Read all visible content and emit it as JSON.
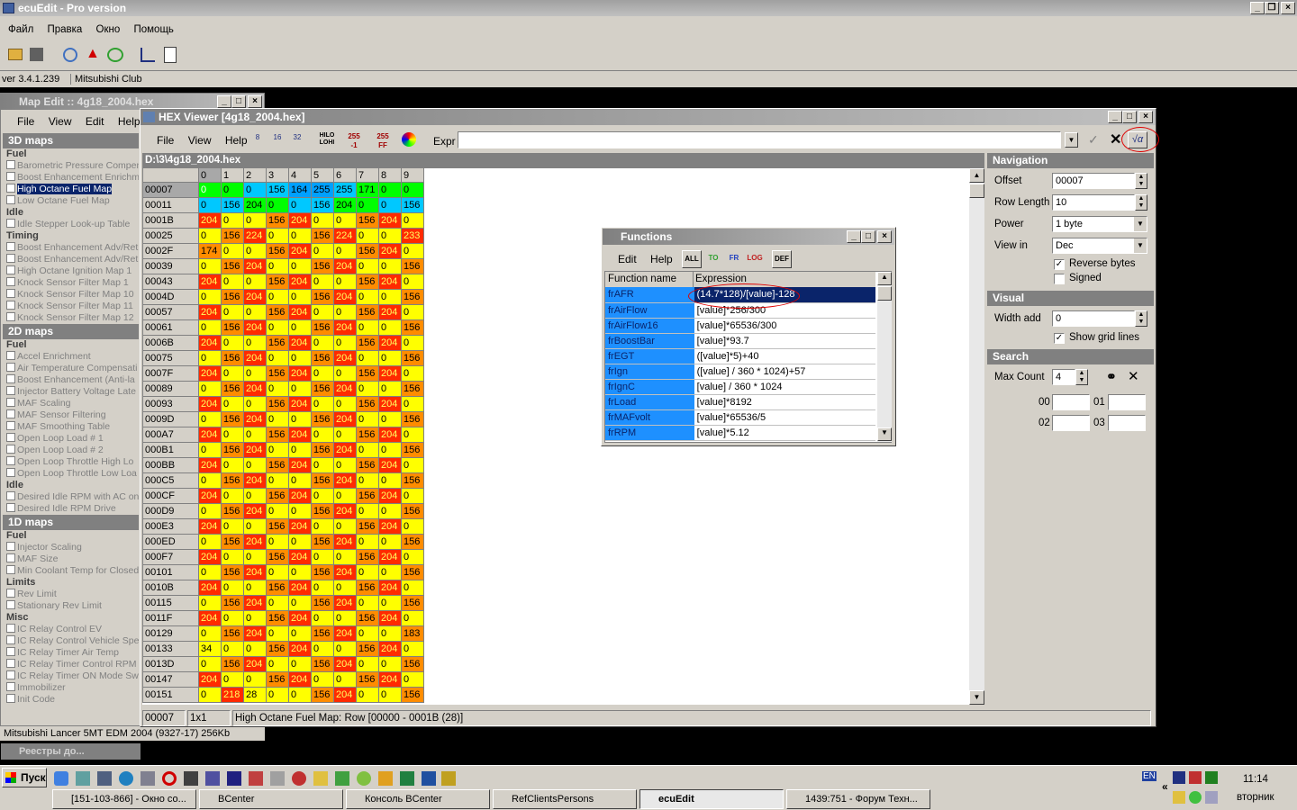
{
  "app": {
    "title": "ecuEdit - Pro version",
    "menu": [
      "Файл",
      "Правка",
      "Окно",
      "Помощь"
    ],
    "version": "ver 3.4.1.239",
    "club": "Mitsubishi Club",
    "status_car": "Mitsubishi Lancer  5MT EDM 2004 (9327-17)  256Kb"
  },
  "map_edit": {
    "title": "Map Edit :: 4g18_2004.hex",
    "menu": [
      "File",
      "View",
      "Edit",
      "Help"
    ]
  },
  "sections": [
    {
      "title": "3D maps",
      "groups": [
        {
          "name": "Fuel",
          "items": [
            "Barometric Pressure Compen",
            "Boost Enhancement Enrichm",
            "High Octane Fuel Map",
            "Low Octane Fuel Map"
          ]
        },
        {
          "name": "Idle",
          "items": [
            "Idle Stepper Look-up Table"
          ]
        },
        {
          "name": "Timing",
          "items": [
            "Boost Enhancement Adv/Ret",
            "Boost Enhancement Adv/Ret",
            "High Octane Ignition Map 1",
            "Knock Sensor Filter Map 1",
            "Knock Sensor Filter Map 10",
            "Knock Sensor Filter Map 11",
            "Knock Sensor Filter Map 12"
          ]
        }
      ]
    },
    {
      "title": "2D maps",
      "groups": [
        {
          "name": "Fuel",
          "items": [
            "Accel Enrichment",
            "Air Temperature Compensati",
            "Boost Enhancement (Anti-la",
            "Injector Battery Voltage Late",
            "MAF Scaling",
            "MAF Sensor Filtering",
            "MAF Smoothing Table",
            "Open Loop Load # 1",
            "Open Loop Load # 2",
            "Open Loop Throttle High Lo",
            "Open Loop Throttle Low Loa"
          ]
        },
        {
          "name": "Idle",
          "items": [
            "Desired Idle RPM with AC on",
            "Desired Idle RPM Drive"
          ]
        }
      ]
    },
    {
      "title": "1D maps",
      "groups": [
        {
          "name": "Fuel",
          "items": [
            "Injector Scaling",
            "MAF Size",
            "Min Coolant Temp for Closed"
          ]
        },
        {
          "name": "Limits",
          "items": [
            "Rev Limit",
            "Stationary Rev Limit"
          ]
        },
        {
          "name": "Misc",
          "items": [
            "IC Relay Control EV",
            "IC Relay Control Vehicle Spe",
            "IC Relay Timer Air Temp",
            "IC Relay Timer Control RPM",
            "IC Relay Timer ON Mode Sw",
            "Immobilizer",
            "Init Code"
          ]
        }
      ]
    }
  ],
  "selected_item": "High Octane Fuel Map",
  "hex": {
    "title": "HEX Viewer [4g18_2004.hex]",
    "menu": [
      "File",
      "View",
      "Help"
    ],
    "expr_label": "Expr",
    "expr_value": "",
    "path": "D:\\3\\4g18_2004.hex",
    "toolbar": [
      "8",
      "16",
      "32",
      "HILO LOHI",
      "255 -1",
      "255 FF"
    ],
    "columns": [
      "0",
      "1",
      "2",
      "3",
      "4",
      "5",
      "6",
      "7",
      "8",
      "9"
    ],
    "rows": [
      [
        "00007",
        "0",
        "0",
        "0",
        "156",
        "164",
        "255",
        "255",
        "171",
        "0",
        "0"
      ],
      [
        "00011",
        "0",
        "156",
        "204",
        "0",
        "0",
        "156",
        "204",
        "0",
        "0",
        "156"
      ],
      [
        "0001B",
        "204",
        "0",
        "0",
        "156",
        "204",
        "0",
        "0",
        "156",
        "204",
        "0"
      ],
      [
        "00025",
        "0",
        "156",
        "224",
        "0",
        "0",
        "156",
        "224",
        "0",
        "0",
        "233"
      ],
      [
        "0002F",
        "174",
        "0",
        "0",
        "156",
        "204",
        "0",
        "0",
        "156",
        "204",
        "0"
      ],
      [
        "00039",
        "0",
        "156",
        "204",
        "0",
        "0",
        "156",
        "204",
        "0",
        "0",
        "156"
      ],
      [
        "00043",
        "204",
        "0",
        "0",
        "156",
        "204",
        "0",
        "0",
        "156",
        "204",
        "0"
      ],
      [
        "0004D",
        "0",
        "156",
        "204",
        "0",
        "0",
        "156",
        "204",
        "0",
        "0",
        "156"
      ],
      [
        "00057",
        "204",
        "0",
        "0",
        "156",
        "204",
        "0",
        "0",
        "156",
        "204",
        "0"
      ],
      [
        "00061",
        "0",
        "156",
        "204",
        "0",
        "0",
        "156",
        "204",
        "0",
        "0",
        "156"
      ],
      [
        "0006B",
        "204",
        "0",
        "0",
        "156",
        "204",
        "0",
        "0",
        "156",
        "204",
        "0"
      ],
      [
        "00075",
        "0",
        "156",
        "204",
        "0",
        "0",
        "156",
        "204",
        "0",
        "0",
        "156"
      ],
      [
        "0007F",
        "204",
        "0",
        "0",
        "156",
        "204",
        "0",
        "0",
        "156",
        "204",
        "0"
      ],
      [
        "00089",
        "0",
        "156",
        "204",
        "0",
        "0",
        "156",
        "204",
        "0",
        "0",
        "156"
      ],
      [
        "00093",
        "204",
        "0",
        "0",
        "156",
        "204",
        "0",
        "0",
        "156",
        "204",
        "0"
      ],
      [
        "0009D",
        "0",
        "156",
        "204",
        "0",
        "0",
        "156",
        "204",
        "0",
        "0",
        "156"
      ],
      [
        "000A7",
        "204",
        "0",
        "0",
        "156",
        "204",
        "0",
        "0",
        "156",
        "204",
        "0"
      ],
      [
        "000B1",
        "0",
        "156",
        "204",
        "0",
        "0",
        "156",
        "204",
        "0",
        "0",
        "156"
      ],
      [
        "000BB",
        "204",
        "0",
        "0",
        "156",
        "204",
        "0",
        "0",
        "156",
        "204",
        "0"
      ],
      [
        "000C5",
        "0",
        "156",
        "204",
        "0",
        "0",
        "156",
        "204",
        "0",
        "0",
        "156"
      ],
      [
        "000CF",
        "204",
        "0",
        "0",
        "156",
        "204",
        "0",
        "0",
        "156",
        "204",
        "0"
      ],
      [
        "000D9",
        "0",
        "156",
        "204",
        "0",
        "0",
        "156",
        "204",
        "0",
        "0",
        "156"
      ],
      [
        "000E3",
        "204",
        "0",
        "0",
        "156",
        "204",
        "0",
        "0",
        "156",
        "204",
        "0"
      ],
      [
        "000ED",
        "0",
        "156",
        "204",
        "0",
        "0",
        "156",
        "204",
        "0",
        "0",
        "156"
      ],
      [
        "000F7",
        "204",
        "0",
        "0",
        "156",
        "204",
        "0",
        "0",
        "156",
        "204",
        "0"
      ],
      [
        "00101",
        "0",
        "156",
        "204",
        "0",
        "0",
        "156",
        "204",
        "0",
        "0",
        "156"
      ],
      [
        "0010B",
        "204",
        "0",
        "0",
        "156",
        "204",
        "0",
        "0",
        "156",
        "204",
        "0"
      ],
      [
        "00115",
        "0",
        "156",
        "204",
        "0",
        "0",
        "156",
        "204",
        "0",
        "0",
        "156"
      ],
      [
        "0011F",
        "204",
        "0",
        "0",
        "156",
        "204",
        "0",
        "0",
        "156",
        "204",
        "0"
      ],
      [
        "00129",
        "0",
        "156",
        "204",
        "0",
        "0",
        "156",
        "204",
        "0",
        "0",
        "183"
      ],
      [
        "00133",
        "34",
        "0",
        "0",
        "156",
        "204",
        "0",
        "0",
        "156",
        "204",
        "0"
      ],
      [
        "0013D",
        "0",
        "156",
        "204",
        "0",
        "0",
        "156",
        "204",
        "0",
        "0",
        "156"
      ],
      [
        "00147",
        "204",
        "0",
        "0",
        "156",
        "204",
        "0",
        "0",
        "156",
        "204",
        "0"
      ],
      [
        "00151",
        "0",
        "218",
        "28",
        "0",
        "0",
        "156",
        "204",
        "0",
        "0",
        "156"
      ]
    ],
    "status": {
      "offset": "00007",
      "size": "1x1",
      "info": "High Octane Fuel Map: Row [00000 - 0001B (28)]"
    },
    "cell_colors": {
      "0": "#ffff00",
      "156": "#ff8c00",
      "204": "#ff2a00",
      "red": "#ff2a00",
      "blue": "#00a0ff",
      "green": "#00ff00",
      "cyan": "#00c8ff"
    }
  },
  "nav": {
    "title": "Navigation",
    "offset_label": "Offset",
    "offset": "00007",
    "rowlen_label": "Row Length",
    "rowlen": "10",
    "power_label": "Power",
    "power": "1 byte",
    "viewin_label": "View in",
    "viewin": "Dec",
    "reverse": "Reverse bytes",
    "signed": "Signed"
  },
  "visual": {
    "title": "Visual",
    "width_label": "Width add",
    "width": "0",
    "grid": "Show grid lines"
  },
  "search": {
    "title": "Search",
    "max_label": "Max Count",
    "max": "4",
    "labels": [
      "00",
      "01",
      "02",
      "03"
    ]
  },
  "functions": {
    "title": "Functions",
    "menu": [
      "Edit",
      "Help"
    ],
    "buttons": [
      "ALL",
      "TO",
      "FR",
      "LOG",
      "DEF"
    ],
    "col_name": "Function name",
    "col_expr": "Expression",
    "rows": [
      [
        "frAFR",
        "(14.7*128)/[value]-128"
      ],
      [
        "frAirFlow",
        "[value]*256/300"
      ],
      [
        "frAirFlow16",
        "[value]*65536/300"
      ],
      [
        "frBoostBar",
        "[value]*93.7"
      ],
      [
        "frEGT",
        "([value]*5)+40"
      ],
      [
        "frIgn",
        "([value] / 360 * 1024)+57"
      ],
      [
        "frIgnC",
        "[value] / 360 * 1024"
      ],
      [
        "frLoad",
        "[value]*8192"
      ],
      [
        "frMAFvolt",
        "[value]*65536/5"
      ],
      [
        "frRPM",
        "[value]*5.12"
      ]
    ]
  },
  "minimized": {
    "title": "Реестры до..."
  },
  "taskbar": {
    "start": "Пуск",
    "clock": "11:14",
    "day": "вторник",
    "lang": "EN",
    "tasks": [
      "[151-103-866] - Окно со...",
      "BCenter",
      "Консоль BCenter",
      "RefClientsPersons",
      "ecuEdit",
      "1439:751 - Форум Техн..."
    ]
  }
}
